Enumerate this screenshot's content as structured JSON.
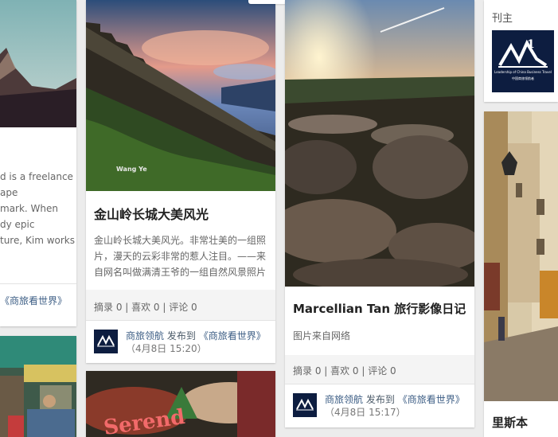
{
  "cards": {
    "left_partial": {
      "desc_lines": [
        "d is a freelance",
        "ape",
        "mark. When",
        "dy epic",
        "ture, Kim works"
      ],
      "board_suffix": "《商旅看世界》"
    },
    "great_wall": {
      "photo_watermark": "Wang  Ye",
      "title": "金山岭长城大美风光",
      "desc_lines": [
        "金山岭长城大美风光。非常壮美的一组照",
        "片，漫天的云彩非常的惹人注目。——来",
        "自网名叫做满清王爷的一组自然风景照片"
      ],
      "stats": "摘录 0 | 喜欢 0 | 评论 0",
      "author": "商旅领航",
      "posted_to": "发布到",
      "board": "《商旅看世界》",
      "time": "（4月8日 15:20）"
    },
    "marcellian": {
      "title": "Marcellian Tan 旅行影像日记",
      "desc": "图片来自网络",
      "stats": "摘录 0 | 喜欢 0 | 评论 0",
      "author": "商旅领航",
      "posted_to": "发布到",
      "board": "《商旅看世界》",
      "time": "（4月8日 15:17）"
    },
    "right_top": {
      "label": "刊主",
      "logo_text": "Leadership of China Business Travel",
      "logo_subtext": "中国商旅领航者"
    },
    "right_bottom": {
      "title": "里斯本"
    },
    "bottom_middle": {
      "sign_text": "Serend"
    }
  },
  "colors": {
    "page_bg": "#ececec",
    "card_bg": "#ffffff",
    "stats_bg": "#f4f4f4",
    "link": "#3d5e85",
    "avatar_bg": "#0d1d40"
  }
}
